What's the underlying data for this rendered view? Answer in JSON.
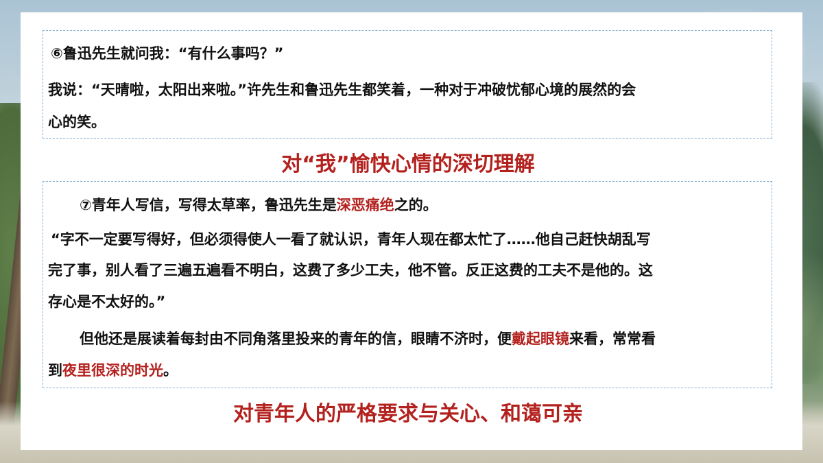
{
  "colors": {
    "accent_red": "#b3211e",
    "border_blue": "#8ab0cf",
    "text": "#111111"
  },
  "section1": {
    "line1": "⑥鲁迅先生就问我：“有什么事吗？”",
    "line2": "我说：“天晴啦，太阳出来啦。”许先生和鲁迅先生都笑着，一种对于冲破忧郁心境的展然的会",
    "line3": "心的笑。"
  },
  "heading1": "对“我”愉快心情的深切理解",
  "section2": {
    "p1_a": "⑦青年人写信，写得太草率，鲁迅先生是",
    "p1_red": "深恶痛绝",
    "p1_b": "之的。",
    "quote_l1": "“字不一定要写得好，但必须得使人一看了就认识，青年人现在都太忙了……他自己赶快胡乱写",
    "quote_l2": "完了事，别人看了三遍五遍看不明白，这费了多少工夫，他不管。反正这费的工夫不是他的。这",
    "quote_l3": "存心是不太好的。”",
    "p3_a": "但他还是展读着每封由不同角落里投来的青年的信，眼睛不济时，便",
    "p3_red1": "戴起眼镜",
    "p3_b": "来看，常常看",
    "p3_c": "到",
    "p3_red2": "夜里很深的时光",
    "p3_d": "。"
  },
  "heading2": "对青年人的严格要求与关心、和蔼可亲"
}
